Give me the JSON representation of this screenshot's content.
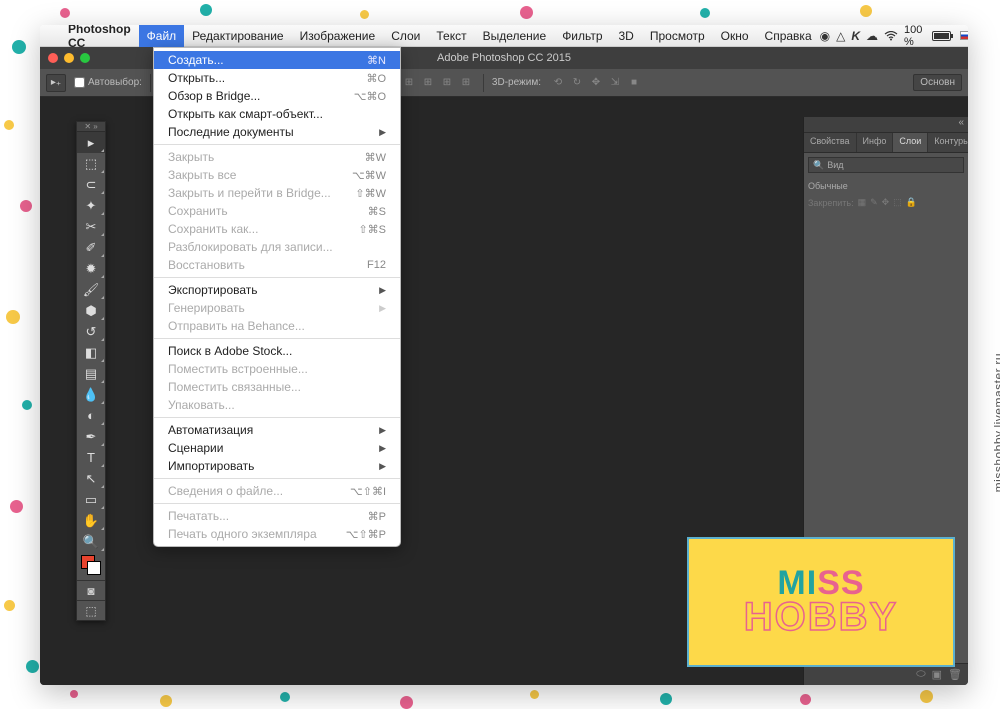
{
  "mac_menubar": {
    "app_name": "Photoshop CC",
    "items": [
      "Файл",
      "Редактирование",
      "Изображение",
      "Слои",
      "Текст",
      "Выделение",
      "Фильтр",
      "3D",
      "Просмотр",
      "Окно",
      "Справка"
    ],
    "selected_index": 0,
    "battery_pct": "100 %"
  },
  "app": {
    "title": "Adobe Photoshop CC 2015"
  },
  "options_bar": {
    "autoselect_label": "Автовыбор:",
    "mode_label": "3D-режим:",
    "right_label": "Основн"
  },
  "file_menu": [
    {
      "label": "Создать...",
      "shortcut": "⌘N",
      "highlighted": true
    },
    {
      "label": "Открыть...",
      "shortcut": "⌘O"
    },
    {
      "label": "Обзор в Bridge...",
      "shortcut": "⌥⌘O"
    },
    {
      "label": "Открыть как смарт-объект..."
    },
    {
      "label": "Последние документы",
      "submenu": true
    },
    {
      "sep": true
    },
    {
      "label": "Закрыть",
      "shortcut": "⌘W",
      "disabled": true
    },
    {
      "label": "Закрыть все",
      "shortcut": "⌥⌘W",
      "disabled": true
    },
    {
      "label": "Закрыть и перейти в Bridge...",
      "shortcut": "⇧⌘W",
      "disabled": true
    },
    {
      "label": "Сохранить",
      "shortcut": "⌘S",
      "disabled": true
    },
    {
      "label": "Сохранить как...",
      "shortcut": "⇧⌘S",
      "disabled": true
    },
    {
      "label": "Разблокировать для записи...",
      "disabled": true
    },
    {
      "label": "Восстановить",
      "shortcut": "F12",
      "disabled": true
    },
    {
      "sep": true
    },
    {
      "label": "Экспортировать",
      "submenu": true
    },
    {
      "label": "Генерировать",
      "submenu": true,
      "disabled": true
    },
    {
      "label": "Отправить на Behance...",
      "disabled": true
    },
    {
      "sep": true
    },
    {
      "label": "Поиск в Adobe Stock..."
    },
    {
      "label": "Поместить встроенные...",
      "disabled": true
    },
    {
      "label": "Поместить связанные...",
      "disabled": true
    },
    {
      "label": "Упаковать...",
      "disabled": true
    },
    {
      "sep": true
    },
    {
      "label": "Автоматизация",
      "submenu": true
    },
    {
      "label": "Сценарии",
      "submenu": true
    },
    {
      "label": "Импортировать",
      "submenu": true
    },
    {
      "sep": true
    },
    {
      "label": "Сведения о файле...",
      "shortcut": "⌥⇧⌘I",
      "disabled": true
    },
    {
      "sep": true
    },
    {
      "label": "Печатать...",
      "shortcut": "⌘P",
      "disabled": true
    },
    {
      "label": "Печать одного экземпляра",
      "shortcut": "⌥⇧⌘P",
      "disabled": true
    }
  ],
  "right_panel": {
    "tabs": [
      "Свойства",
      "Инфо",
      "Слои",
      "Контуры"
    ],
    "active_tab": 2,
    "search_label": "Вид",
    "blend_mode": "Обычные",
    "lock_label": "Закрепить:"
  },
  "toolbox": {
    "tools": [
      "move",
      "marquee",
      "lasso",
      "wand",
      "crop",
      "eyedropper",
      "brush-heal",
      "brush",
      "stamp",
      "history-brush",
      "eraser",
      "gradient",
      "blur",
      "dodge",
      "pen",
      "type",
      "path-select",
      "rectangle",
      "hand",
      "zoom"
    ]
  },
  "watermark": {
    "line1": "MISS",
    "line2": "HOBBY"
  },
  "side_text": "misshobby.livemaster.ru"
}
